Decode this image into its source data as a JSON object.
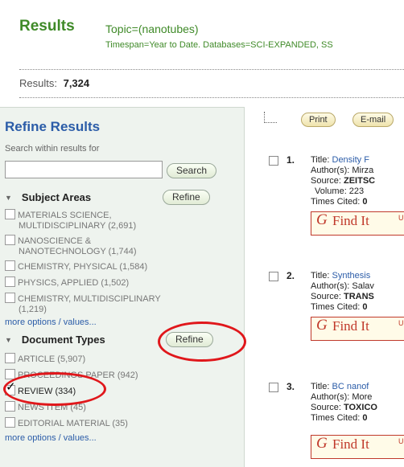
{
  "header": {
    "title": "Results",
    "topic": "Topic=(nanotubes)",
    "timespan": "Timespan=Year to Date. Databases=SCI-EXPANDED, SS",
    "results_label": "Results:",
    "results_count": "7,324"
  },
  "sidebar": {
    "title": "Refine Results",
    "search_label": "Search within results for",
    "search_value": "",
    "search_button": "Search",
    "subject_areas": {
      "heading": "Subject Areas",
      "refine_button": "Refine",
      "items": [
        {
          "line1": "MATERIALS SCIENCE,",
          "line2": "MULTIDISCIPLINARY (2,691)"
        },
        {
          "line1": "NANOSCIENCE &",
          "line2": "NANOTECHNOLOGY (1,744)"
        },
        {
          "line1": "CHEMISTRY, PHYSICAL (1,584)",
          "line2": ""
        },
        {
          "line1": "PHYSICS, APPLIED (1,502)",
          "line2": ""
        },
        {
          "line1": "CHEMISTRY, MULTIDISCIPLINARY",
          "line2": "(1,219)"
        }
      ],
      "more_link": "more options / values..."
    },
    "document_types": {
      "heading": "Document Types",
      "refine_button": "Refine",
      "items": [
        {
          "label": "ARTICLE (5,907)",
          "checked": false
        },
        {
          "label": "PROCEEDINGS PAPER (942)",
          "checked": false
        },
        {
          "label": "REVIEW (334)",
          "checked": true
        },
        {
          "label": "NEWS ITEM (45)",
          "checked": false
        },
        {
          "label": "EDITORIAL MATERIAL (35)",
          "checked": false
        }
      ],
      "more_link": "more options / values..."
    }
  },
  "toolbar": {
    "print_label": "Print",
    "email_label": "E-mail"
  },
  "records": [
    {
      "num": "1.",
      "title_prefix": "Title:",
      "title": "Density F",
      "authors_prefix": "Author(s):",
      "authors": "Mirza",
      "source_prefix": "Source:",
      "source": "ZEITSC",
      "volume": "Volume: 223",
      "cited_prefix": "Times Cited:",
      "cited": "0"
    },
    {
      "num": "2.",
      "title_prefix": "Title:",
      "title": "Synthesis",
      "authors_prefix": "Author(s):",
      "authors": "Salav",
      "source_prefix": "Source:",
      "source": "TRANS",
      "volume": "",
      "cited_prefix": "Times Cited:",
      "cited": "0"
    },
    {
      "num": "3.",
      "title_prefix": "Title:",
      "title": "BC nanof",
      "authors_prefix": "Author(s):",
      "authors": "More",
      "source_prefix": "Source:",
      "source": "TOXICO",
      "volume": "",
      "cited_prefix": "Times Cited:",
      "cited": "0"
    }
  ],
  "findit": {
    "logo": "G",
    "label": "Find It",
    "sup": "U"
  },
  "colors": {
    "green": "#3f8a28",
    "link_blue": "#2b5ca8",
    "highlight_red": "#e0171b",
    "sidebar_bg": "#eef3ee"
  }
}
